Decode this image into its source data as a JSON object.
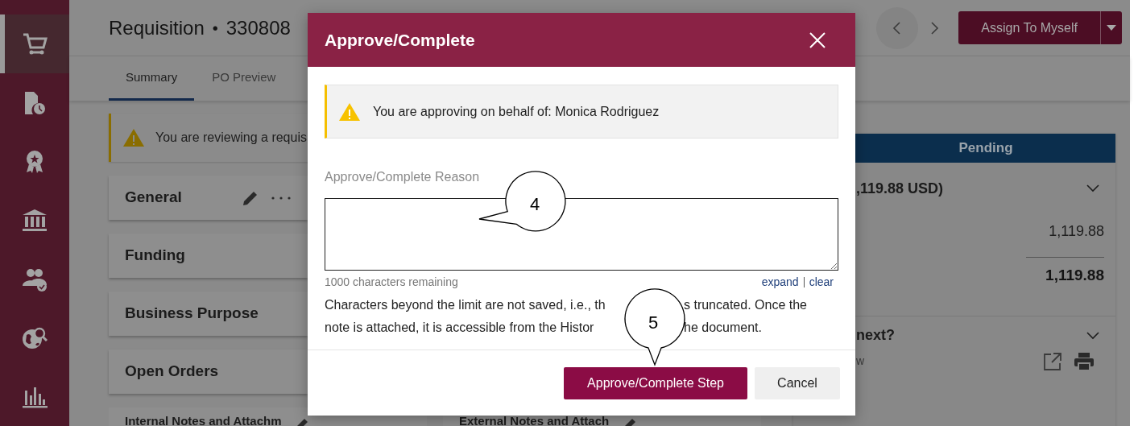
{
  "sidebar": {
    "items": [
      {
        "kind": "cart",
        "selected": true
      },
      {
        "kind": "document-clock",
        "selected": false
      },
      {
        "kind": "award",
        "selected": false
      },
      {
        "kind": "bank",
        "selected": false
      },
      {
        "kind": "people-check",
        "selected": false
      },
      {
        "kind": "globe-search",
        "selected": false
      },
      {
        "kind": "bar-chart",
        "selected": false
      }
    ]
  },
  "header": {
    "title": "Requisition",
    "separator": "•",
    "number": "330808",
    "assign_button": "Assign To Myself"
  },
  "tabs": [
    {
      "label": "Summary",
      "selected": true
    },
    {
      "label": "PO Preview",
      "selected": false
    }
  ],
  "banner": {
    "text": "You are reviewing a requis"
  },
  "sections": [
    {
      "title": "General",
      "actions": true
    },
    {
      "title": "Funding",
      "actions": false
    },
    {
      "title": "Business Purpose",
      "actions": false
    },
    {
      "title": "Open Orders",
      "actions": false
    }
  ],
  "bottom_sections": [
    {
      "title": "Internal Notes and Attachm"
    },
    {
      "title": "External Notes and Attach"
    }
  ],
  "summary_panel": {
    "status": "Pending",
    "total_heading": ",119.88 USD)",
    "amount": "1,119.88",
    "total": "1,119.88",
    "next_heading": "next?",
    "next_text": "w"
  },
  "dialog": {
    "title": "Approve/Complete",
    "notice": "You are approving on behalf of: Monica Rodriguez",
    "reason_label": "Approve/Complete Reason",
    "remaining": "1000 characters remaining",
    "links": [
      "expand",
      "clear"
    ],
    "help_lines": [
      [
        "Characters beyond the limit are not saved, i.e., th",
        "s truncated. Once the"
      ],
      [
        "note is attached, it is accessible from the Histor",
        "he document."
      ]
    ],
    "primary_button": "Approve/Complete Step",
    "cancel_button": "Cancel"
  },
  "callouts": [
    {
      "number": "4"
    },
    {
      "number": "5"
    }
  ]
}
